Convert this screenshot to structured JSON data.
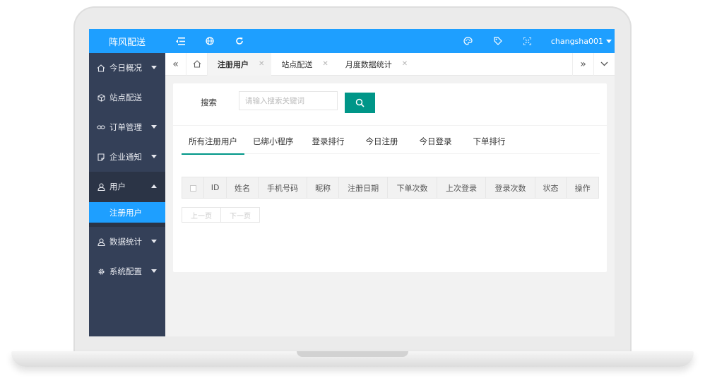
{
  "header": {
    "logo": "阵风配送",
    "user_name": "changsha001",
    "colors": {
      "primary": "#1e9fff",
      "sidebar": "#344058",
      "accent": "#009688"
    }
  },
  "sidebar": {
    "items": [
      {
        "label": "今日概况",
        "icon": "home-icon"
      },
      {
        "label": "站点配送",
        "icon": "cube-icon"
      },
      {
        "label": "订单管理",
        "icon": "link-icon"
      },
      {
        "label": "企业通知",
        "icon": "note-icon"
      },
      {
        "label": "用户",
        "icon": "user-icon",
        "expanded": true
      },
      {
        "label": "数据统计",
        "icon": "user-icon"
      },
      {
        "label": "系统配置",
        "icon": "gear-icon"
      }
    ],
    "sub_items": [
      {
        "label": "注册用户"
      }
    ]
  },
  "tabs": [
    {
      "label": "注册用户",
      "active": true
    },
    {
      "label": "站点配送"
    },
    {
      "label": "月度数据统计"
    }
  ],
  "search": {
    "label": "搜索",
    "placeholder": "请输入搜索关键词"
  },
  "sub_tabs": [
    {
      "label": "所有注册用户",
      "active": true
    },
    {
      "label": "已绑小程序"
    },
    {
      "label": "登录排行"
    },
    {
      "label": "今日注册"
    },
    {
      "label": "今日登录"
    },
    {
      "label": "下单排行"
    }
  ],
  "table": {
    "columns": [
      "ID",
      "姓名",
      "手机号码",
      "昵称",
      "注册日期",
      "下单次数",
      "上次登录",
      "登录次数",
      "状态",
      "操作"
    ]
  },
  "pager": {
    "prev": "上一页",
    "next": "下一页"
  }
}
